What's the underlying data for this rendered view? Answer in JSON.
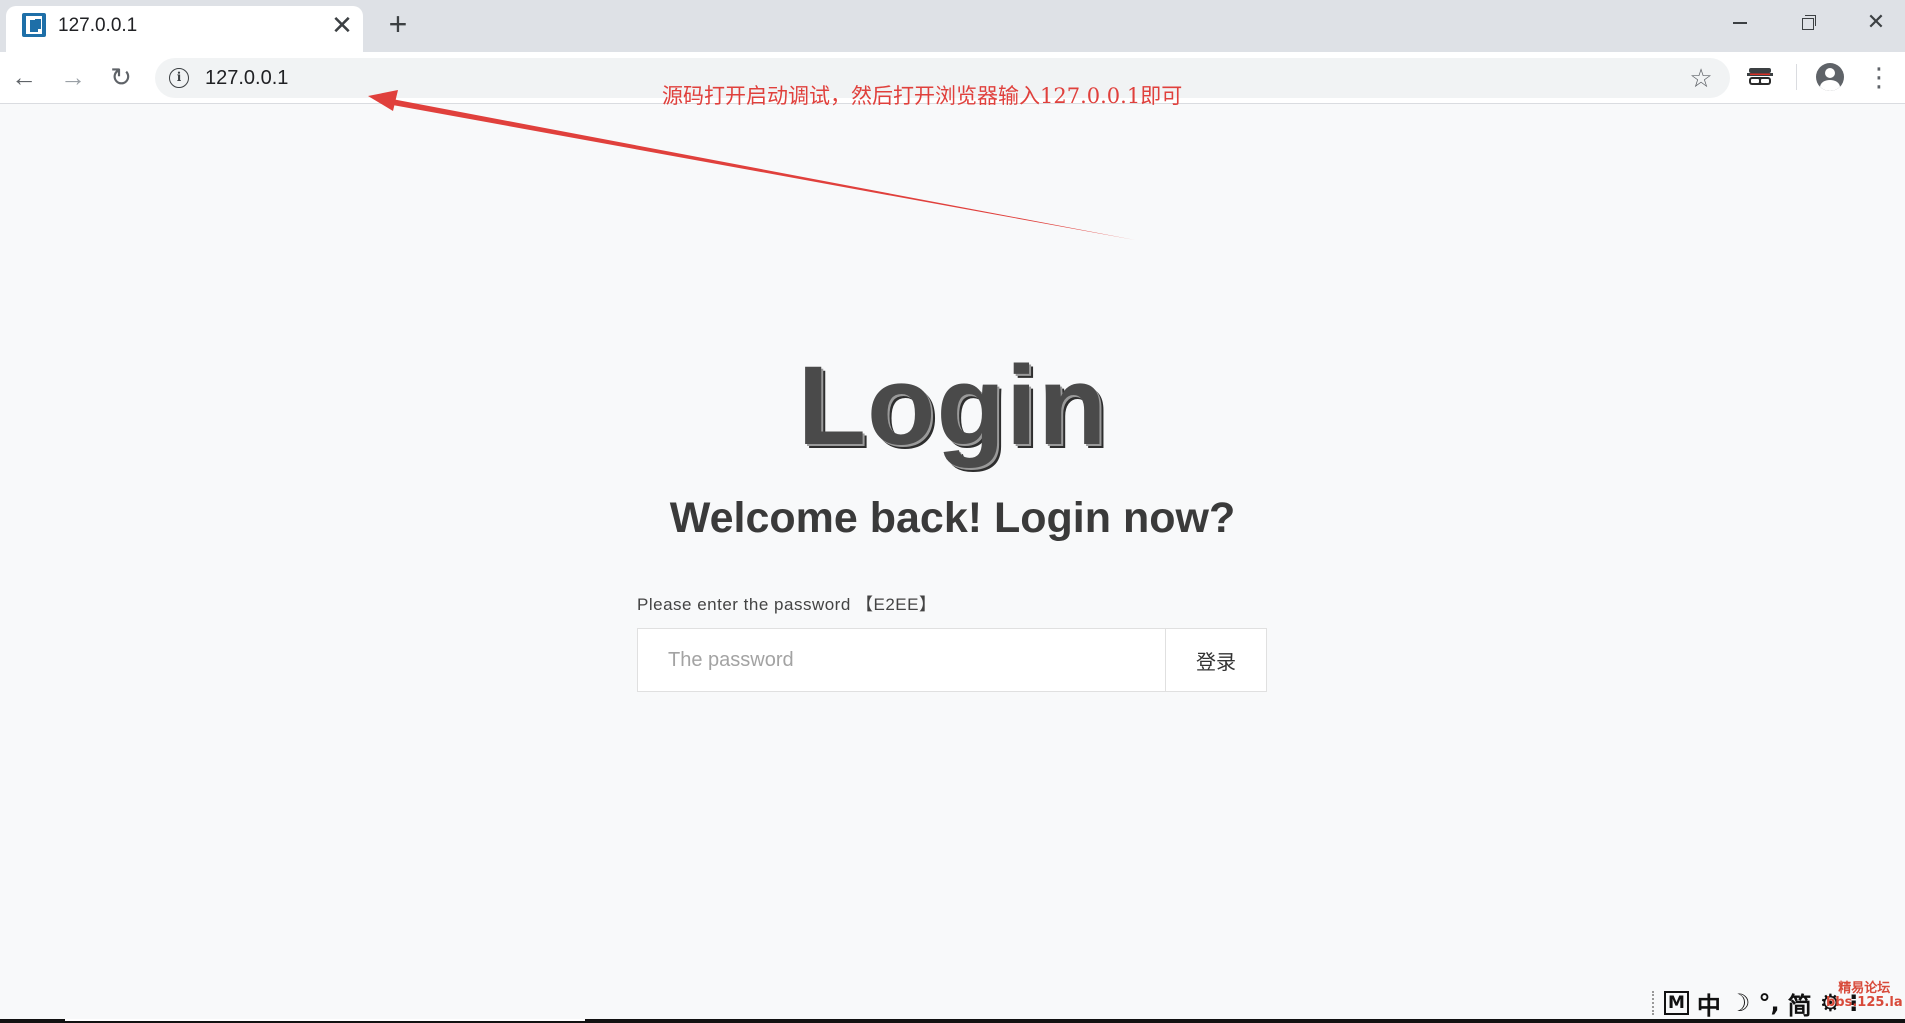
{
  "browser": {
    "tab_title": "127.0.0.1",
    "tab_close_glyph": "✕",
    "new_tab_glyph": "+",
    "window_close_glyph": "✕",
    "url": "127.0.0.1",
    "info_glyph": "i",
    "back_glyph": "←",
    "forward_glyph": "→",
    "reload_glyph": "↻",
    "star_glyph": "☆",
    "menu_glyph": "⋮",
    "icons": [
      "favicon",
      "close-icon",
      "plus-icon",
      "minimize-icon",
      "restore-icon",
      "back-arrow-icon",
      "forward-arrow-icon",
      "reload-icon",
      "info-icon",
      "star-icon",
      "incognito-extension-icon",
      "profile-icon",
      "more-vert-icon"
    ]
  },
  "annotation": {
    "text": "源码打开启动调试，然后打开浏览器输入127.0.0.1即可",
    "color": "#e0403c"
  },
  "page": {
    "heading": "Login",
    "subtitle": "Welcome back! Login now?",
    "password_label": "Please enter the password 【E2EE】",
    "password_placeholder": "The password",
    "password_value": "",
    "login_button": "登录"
  },
  "taskbar": {
    "ime_mode": "M",
    "ime_lang": "中",
    "ime_moon": "☽",
    "ime_punct": "°,",
    "ime_simplified": "简",
    "ime_settings": "⚙",
    "ime_more": "⁝"
  },
  "watermark": {
    "line1": "精易论坛",
    "line2": "bbs.125.la"
  },
  "colors": {
    "page_bg": "#f8f9fa",
    "tabstrip_bg": "#dee1e6",
    "annotation_red": "#e0403c",
    "heading": "#4a4a4a"
  }
}
